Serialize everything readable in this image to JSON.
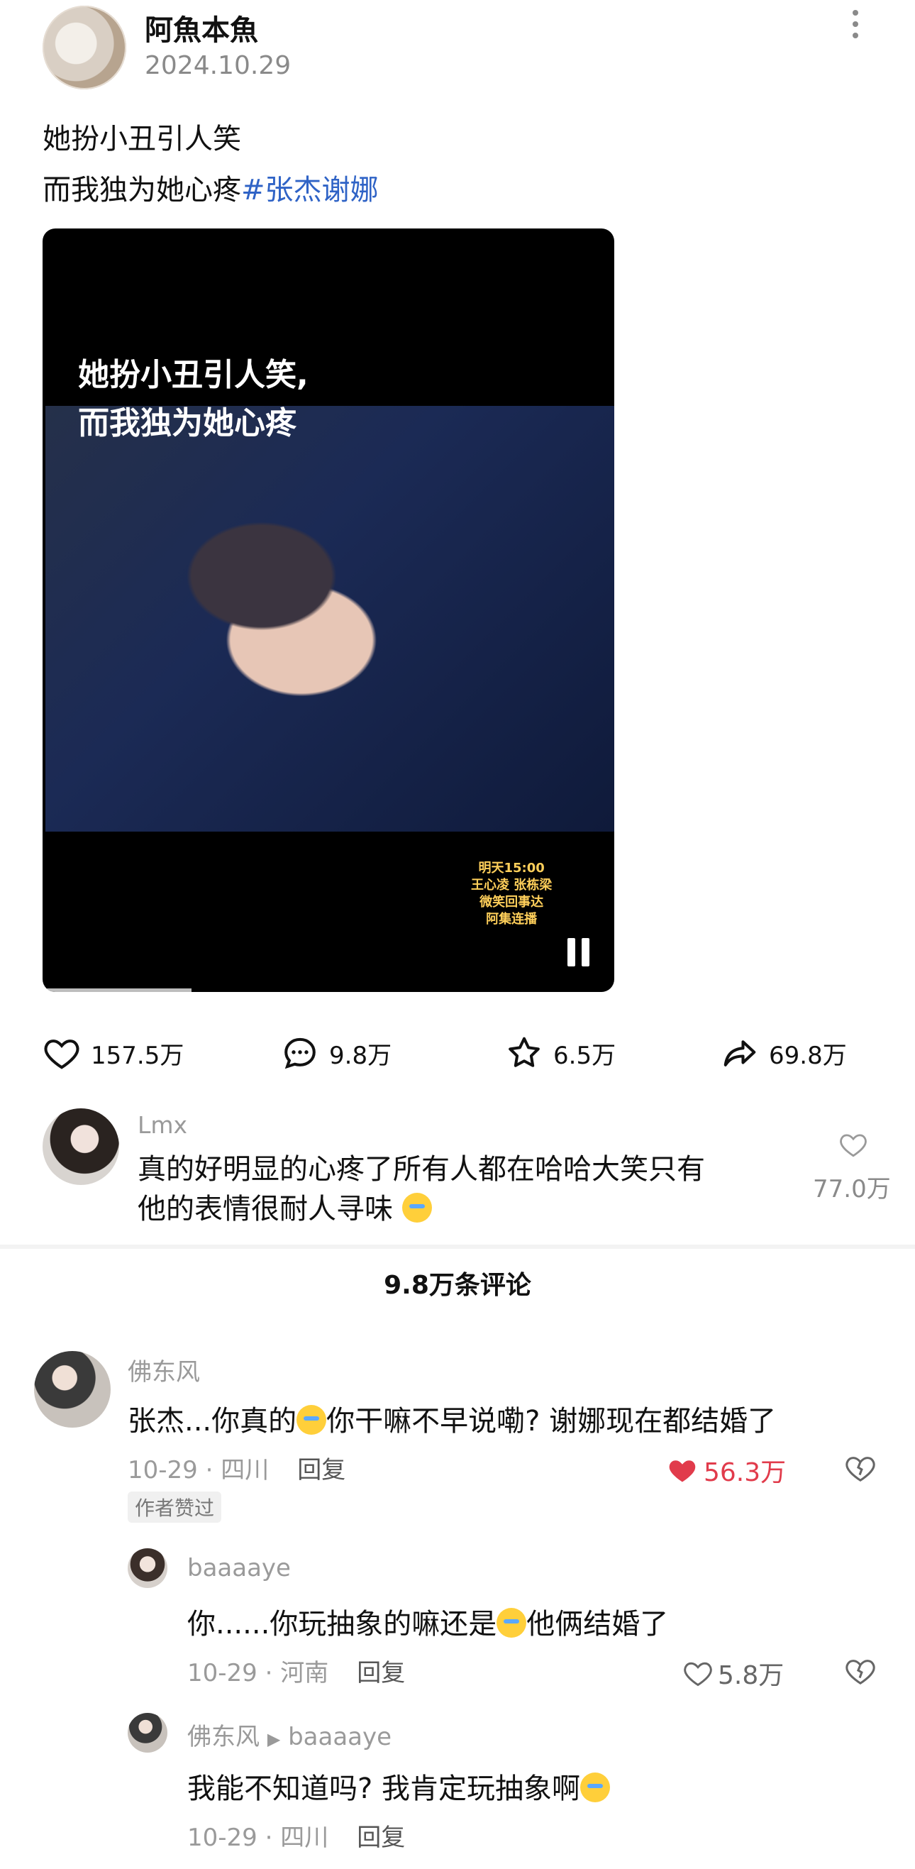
{
  "post": {
    "author": "阿魚本魚",
    "date": "2024.10.29",
    "caption_line1": "她扮小丑引人笑",
    "caption_line2": "而我独为她心疼",
    "hashtag": "#张杰谢娜"
  },
  "video": {
    "subtitle_line1": "她扮小丑引人笑,",
    "subtitle_line2": "而我独为她心疼",
    "overlay_credit": [
      "明天15:00",
      "王心凌 张栋梁",
      "微笑回事达",
      "阿集连播"
    ],
    "progress": 0.26
  },
  "actions": {
    "likes": "157.5万",
    "comments": "9.8万",
    "favorites": "6.5万",
    "shares": "69.8万"
  },
  "pinned_comment": {
    "name": "Lmx",
    "text_line1": "真的好明显的心疼了所有人都在哈哈大笑只有",
    "text_line2": "他的表情很耐人寻味",
    "likes": "77.0万"
  },
  "comments_count_title": "9.8万条评论",
  "comments": [
    {
      "name": "佛东风",
      "text_before_emoji": "张杰...你真的",
      "text_after_emoji": "你干嘛不早说嘞? 谢娜现在都结婚了",
      "meta": "10-29 · 四川",
      "reply_label": "回复",
      "likes": "56.3万",
      "badge": "作者赞过"
    },
    {
      "name": "baaaaye",
      "text_before_emoji": "你......你玩抽象的嘛还是",
      "text_after_emoji": "他俩结婚了",
      "meta": "10-29 · 河南",
      "reply_label": "回复",
      "likes": "5.8万"
    },
    {
      "name": "佛东风",
      "reply_to": "baaaaye",
      "text_before_emoji": "我能不知道吗? 我肯定玩抽象啊",
      "meta": "10-29 · 四川",
      "reply_label": "回复"
    }
  ],
  "icons": {
    "like": "heart-icon",
    "comment": "comment-bubble-icon",
    "favorite": "star-icon",
    "share": "share-arrow-icon",
    "dislike": "broken-heart-icon",
    "pause": "pause-icon",
    "more": "more-vertical-icon",
    "emoji": "crying-face-emoji"
  },
  "colors": {
    "hashtag": "#2f63c6",
    "liked": "#e13b4b",
    "muted": "#9a9a9a"
  }
}
